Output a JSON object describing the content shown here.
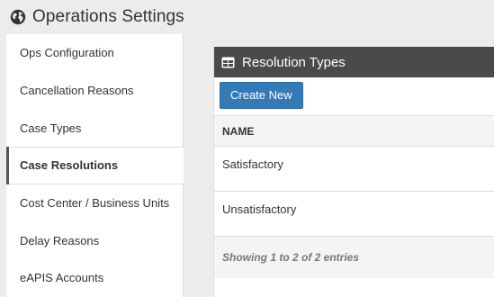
{
  "header": {
    "title": "Operations Settings",
    "icon": "globe-icon"
  },
  "sidebar": {
    "items": [
      {
        "label": "Ops Configuration"
      },
      {
        "label": "Cancellation Reasons"
      },
      {
        "label": "Case Types"
      },
      {
        "label": "Case Resolutions",
        "active": true
      },
      {
        "label": "Cost Center / Business Units"
      },
      {
        "label": "Delay Reasons"
      },
      {
        "label": "eAPIS Accounts"
      }
    ]
  },
  "panel": {
    "title": "Resolution Types",
    "icon": "table-icon",
    "create_label": "Create New",
    "columns": [
      "NAME"
    ],
    "rows": [
      "Satisfactory",
      "Unsatisfactory"
    ],
    "footer": "Showing 1 to 2 of 2 entries"
  },
  "colors": {
    "panel_header": "#4a4a4a",
    "primary_button": "#337ab7",
    "background": "#ececec"
  }
}
